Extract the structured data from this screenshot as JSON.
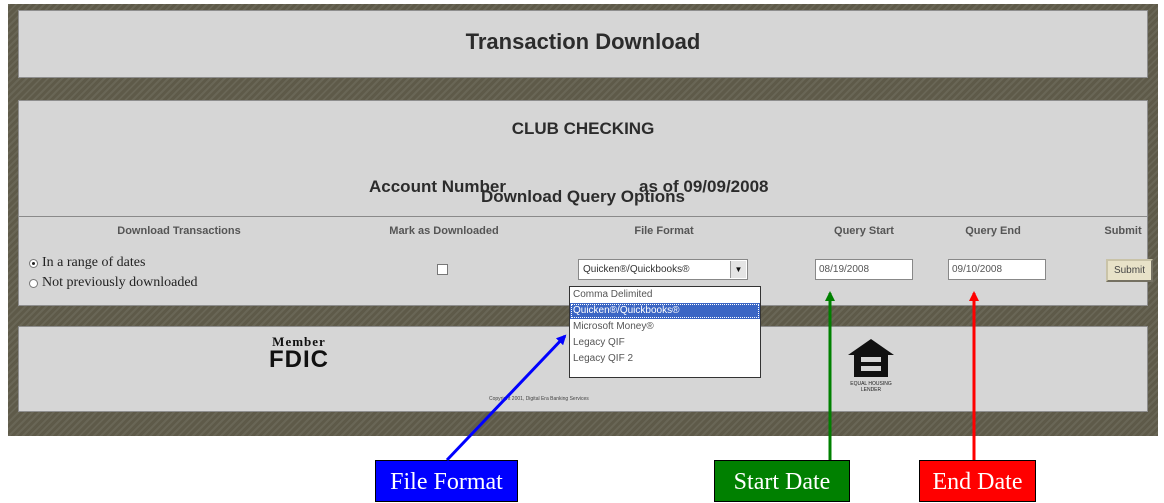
{
  "header": {
    "title": "Transaction Download"
  },
  "account": {
    "name": "CLUB CHECKING",
    "number_label": "Account Number",
    "as_of": "as of 09/09/2008",
    "options_title": "Download Query Options"
  },
  "columns": {
    "download": "Download Transactions",
    "mark": "Mark as Downloaded",
    "format": "File Format",
    "start": "Query Start",
    "end": "Query End",
    "submit": "Submit"
  },
  "download_options": [
    {
      "label": "In a range of dates",
      "selected": true
    },
    {
      "label": "Not previously downloaded",
      "selected": false
    }
  ],
  "mark_downloaded": false,
  "file_format": {
    "selected": "Quicken®/Quickbooks®",
    "options": [
      "Comma Delimited",
      "Quicken®/Quickbooks®",
      "Microsoft Money®",
      "Legacy QIF",
      "Legacy QIF 2"
    ],
    "selected_index": 1
  },
  "query_start": "08/19/2008",
  "query_end": "09/10/2008",
  "submit_label": "Submit",
  "footer": {
    "fdic_member": "Member",
    "fdic_name": "FDIC",
    "ehl_text": "EQUAL HOUSING LENDER",
    "copyright": "Copyright 2001, Digital Era Banking Services"
  },
  "callouts": [
    {
      "label": "File Format",
      "color": "#0000ff"
    },
    {
      "label": "Start Date",
      "color": "#008000"
    },
    {
      "label": "End Date",
      "color": "#ff0000"
    }
  ]
}
